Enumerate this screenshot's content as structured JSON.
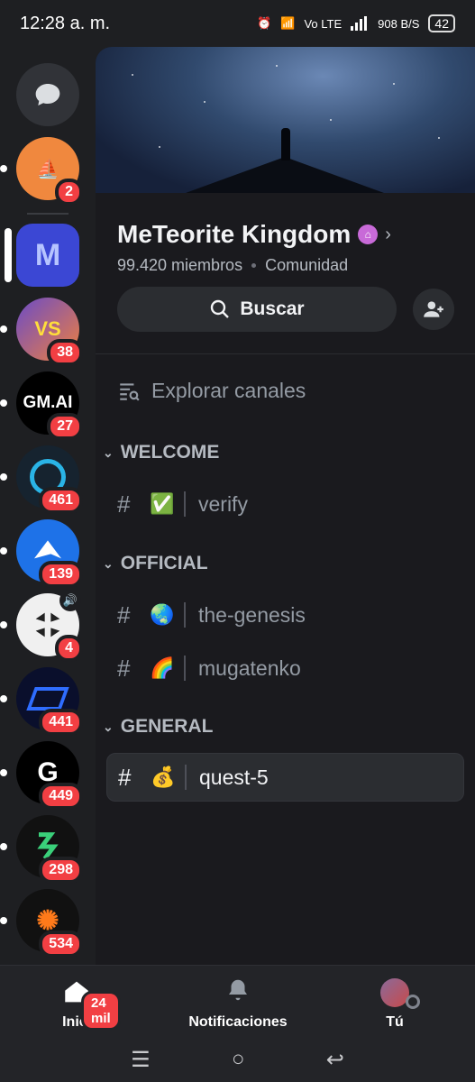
{
  "status_bar": {
    "time": "12:28 a. m.",
    "network": "Vo LTE",
    "speed": "908 B/S",
    "battery": "42"
  },
  "servers": [
    {
      "kind": "dm",
      "icon": "chat-bubble-icon"
    },
    {
      "badge": "2",
      "color": "#f0883e",
      "icon": "ship-logo"
    },
    {
      "badge": "",
      "color": "#3b47d4",
      "icon": "m-logo",
      "active": true,
      "label": "M"
    },
    {
      "badge": "38",
      "color": "#6a4bc7",
      "icon": "vs-logo",
      "label": "VS"
    },
    {
      "badge": "27",
      "color": "#000000",
      "icon": "gm-ai-logo",
      "label": "GM.AI"
    },
    {
      "badge": "461",
      "color": "#16232f",
      "icon": "orb-logo"
    },
    {
      "badge": "139",
      "color": "#1e72e8",
      "icon": "bird-logo"
    },
    {
      "badge": "4",
      "color": "#f0f0f0",
      "icon": "cube-logo"
    },
    {
      "badge": "441",
      "color": "#0a0f2c",
      "icon": "blue-frame-logo"
    },
    {
      "badge": "449",
      "color": "#000000",
      "icon": "g-arrow-logo"
    },
    {
      "badge": "298",
      "color": "#111111",
      "icon": "green-zigzag-logo"
    },
    {
      "badge": "534",
      "color": "#111111",
      "icon": "orange-burst-logo"
    }
  ],
  "server": {
    "name": "MeTeorite Kingdom",
    "members": "99.420 miembros",
    "type": "Comunidad",
    "search_label": "Buscar",
    "browse_label": "Explorar canales"
  },
  "categories": [
    {
      "name": "WELCOME",
      "channels": [
        {
          "emoji": "✅",
          "name": "verify"
        }
      ]
    },
    {
      "name": "OFFICIAL",
      "channels": [
        {
          "emoji": "🌏",
          "name": "the-genesis"
        },
        {
          "emoji": "🌈",
          "name": "mugatenko"
        }
      ]
    },
    {
      "name": "GENERAL",
      "channels": [
        {
          "emoji": "💰",
          "name": "quest-5",
          "selected": true
        }
      ]
    }
  ],
  "bottom_nav": {
    "home_label": "Inicio",
    "home_badge": "24 mil",
    "notifications_label": "Notificaciones",
    "you_label": "Tú"
  },
  "colors": {
    "accent_red": "#f23f43",
    "panel": "#1a1a1e",
    "rail": "#1e1f22"
  }
}
